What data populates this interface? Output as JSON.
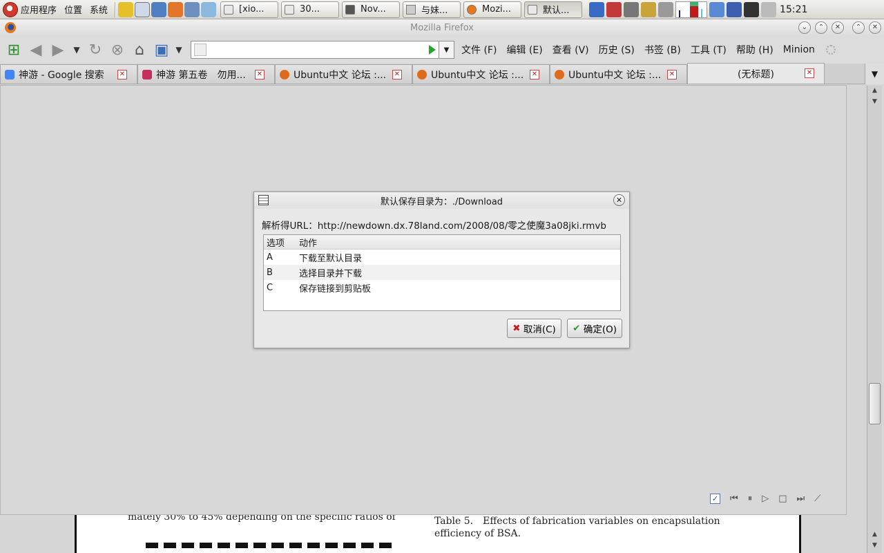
{
  "panel": {
    "menus": [
      "应用程序",
      "位置",
      "系统"
    ],
    "tasks": [
      "[xio...",
      "30...",
      "Nov...",
      "与妹...",
      "Mozi...",
      "默认..."
    ],
    "clock": "15:21"
  },
  "window": {
    "title": "Mozilla Firefox"
  },
  "navbar": {
    "url_value": "",
    "menu": [
      "文件 (F)",
      "编辑 (E)",
      "查看 (V)",
      "历史 (S)",
      "书签 (B)",
      "工具 (T)",
      "帮助 (H)",
      "Minion"
    ]
  },
  "tabs": [
    {
      "label": "神游 - Google 搜索"
    },
    {
      "label": "神游 第五卷　勿用..."
    },
    {
      "label": "Ubuntu中文 论坛 :..."
    },
    {
      "label": "Ubuntu中文 论坛 :..."
    },
    {
      "label": "Ubuntu中文 论坛 :..."
    },
    {
      "label": "(无标题)"
    }
  ],
  "dialog": {
    "title": "默认保存目录为：./Download",
    "url_text": "解析得URL：http://newdown.dx.78land.com/2008/08/零之使魔3a08jki.rmvb",
    "headers": [
      "选项",
      "动作"
    ],
    "rows": [
      {
        "key": "A",
        "action": "下载至默认目录"
      },
      {
        "key": "B",
        "action": "选择目录并下载"
      },
      {
        "key": "C",
        "action": "保存链接到剪贴板"
      }
    ],
    "cancel_label": "取消(C)",
    "ok_label": "确定(O)"
  },
  "pdf": {
    "left_text": "mately 30% to 45% depending on the specific ratios of",
    "right_text": "Table 5.　Effects of fabrication variables on encapsulation efficiency of BSA."
  },
  "colors": {
    "accent_cancel": "#c01b1b",
    "accent_ok": "#2f9a2f"
  }
}
